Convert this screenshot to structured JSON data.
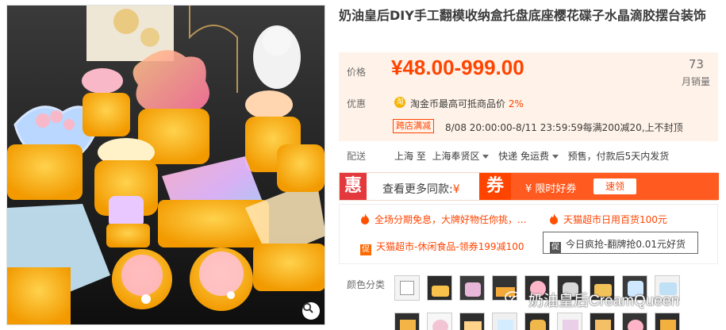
{
  "product": {
    "title": "奶油皇后DIY手工翻模收纳盒托盘底座樱花碟子水晶滴胶摆台装饰"
  },
  "price": {
    "label": "价格",
    "value": "¥48.00-999.00",
    "sales_count": "73",
    "sales_label": "月销量"
  },
  "offers": {
    "label": "优惠",
    "coin_icon": "淘",
    "coin_text": "淘金币最高可抵商品价",
    "coin_percent": "2%",
    "promo_tag": "跨店满减",
    "promo_text": "8/08 20:00:00-8/11 23:59:59每满200减20,上不封顶"
  },
  "shipping": {
    "label": "配送",
    "from": "上海 至",
    "to": "上海奉贤区",
    "method": "快递 免运费",
    "presale": "预售，付款后5天内发货"
  },
  "coupon_strip": {
    "hui": "惠",
    "more_text": "查看更多同款:",
    "more_yen": "¥",
    "quan": "券",
    "quan_label": "¥ 限时好券",
    "quan_button": "速领"
  },
  "promos": {
    "item1": "全场分期免息，大牌好物任你挑，...",
    "item2": "天猫超市日用百货100元",
    "item3_badge": "促",
    "item3": "天猫超市-休闲食品-领券199减100",
    "item4_badge": "促",
    "item4": "今日疯抢-翻牌抢0.01元好货"
  },
  "colors": {
    "label": "颜色分类"
  },
  "watermark": {
    "text": "奶油皇后CreamQueen"
  },
  "icons": [
    "search-zoom-icon",
    "gold-coin-icon",
    "fire-icon",
    "caret-down-icon",
    "wechat-icon"
  ],
  "theme": {
    "accent": "#ff4400",
    "price_bg": "#fff2e8",
    "hui_red": "#e4393c"
  }
}
